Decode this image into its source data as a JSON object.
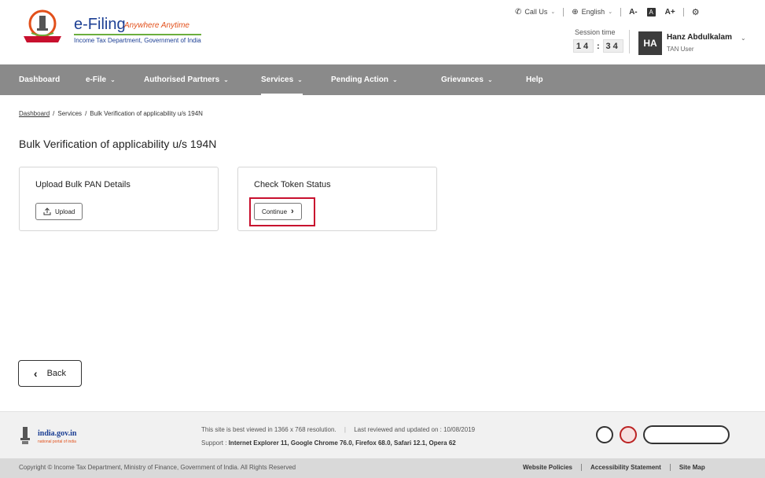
{
  "brand": {
    "title": "e-Filing",
    "tagline": "Anywhere Anytime",
    "subtitle": "Income Tax Department, Government of India"
  },
  "top_links": {
    "call_us": "Call Us",
    "language": "English",
    "font_decrease": "A-",
    "font_default": "A",
    "font_increase": "A+"
  },
  "session": {
    "label": "Session time",
    "minutes": "14",
    "seconds": "34"
  },
  "user": {
    "initials": "HA",
    "name": "Hanz Abdulkalam",
    "role": "TAN User"
  },
  "nav": [
    {
      "label": "Dashboard",
      "has_caret": false
    },
    {
      "label": "e-File",
      "has_caret": true
    },
    {
      "label": "Authorised Partners",
      "has_caret": true
    },
    {
      "label": "Services",
      "has_caret": true,
      "active": true
    },
    {
      "label": "Pending Action",
      "has_caret": true
    },
    {
      "label": "Grievances",
      "has_caret": true
    },
    {
      "label": "Help",
      "has_caret": false
    }
  ],
  "breadcrumb": [
    "Dashboard",
    "Services",
    "Bulk Verification of applicability u/s 194N"
  ],
  "page_title": "Bulk Verification of applicability u/s 194N",
  "cards": [
    {
      "title": "Upload Bulk PAN Details",
      "button": "Upload"
    },
    {
      "title": "Check Token Status",
      "button": "Continue"
    }
  ],
  "back_button": "Back",
  "footer": {
    "site_name": "india.gov.in",
    "site_sub": "national portal of india",
    "best_viewed": "This site is best viewed in 1366 x 768 resolution.",
    "last_reviewed": "Last reviewed and updated on : 10/08/2019",
    "support_prefix": "Support :",
    "support_browsers": "Internet Explorer 11, Google Chrome 76.0, Firefox 68.0, Safari 12.1, Opera 62",
    "copyright": "Copyright © Income Tax Department, Ministry of Finance, Government of India. All Rights Reserved",
    "links": [
      "Website Policies",
      "Accessibility Statement",
      "Site Map"
    ]
  },
  "colors": {
    "brand_blue": "#1c3f94",
    "brand_orange": "#e2501b",
    "nav_bg": "#8a8a8a",
    "highlight_red": "#c8102e"
  }
}
